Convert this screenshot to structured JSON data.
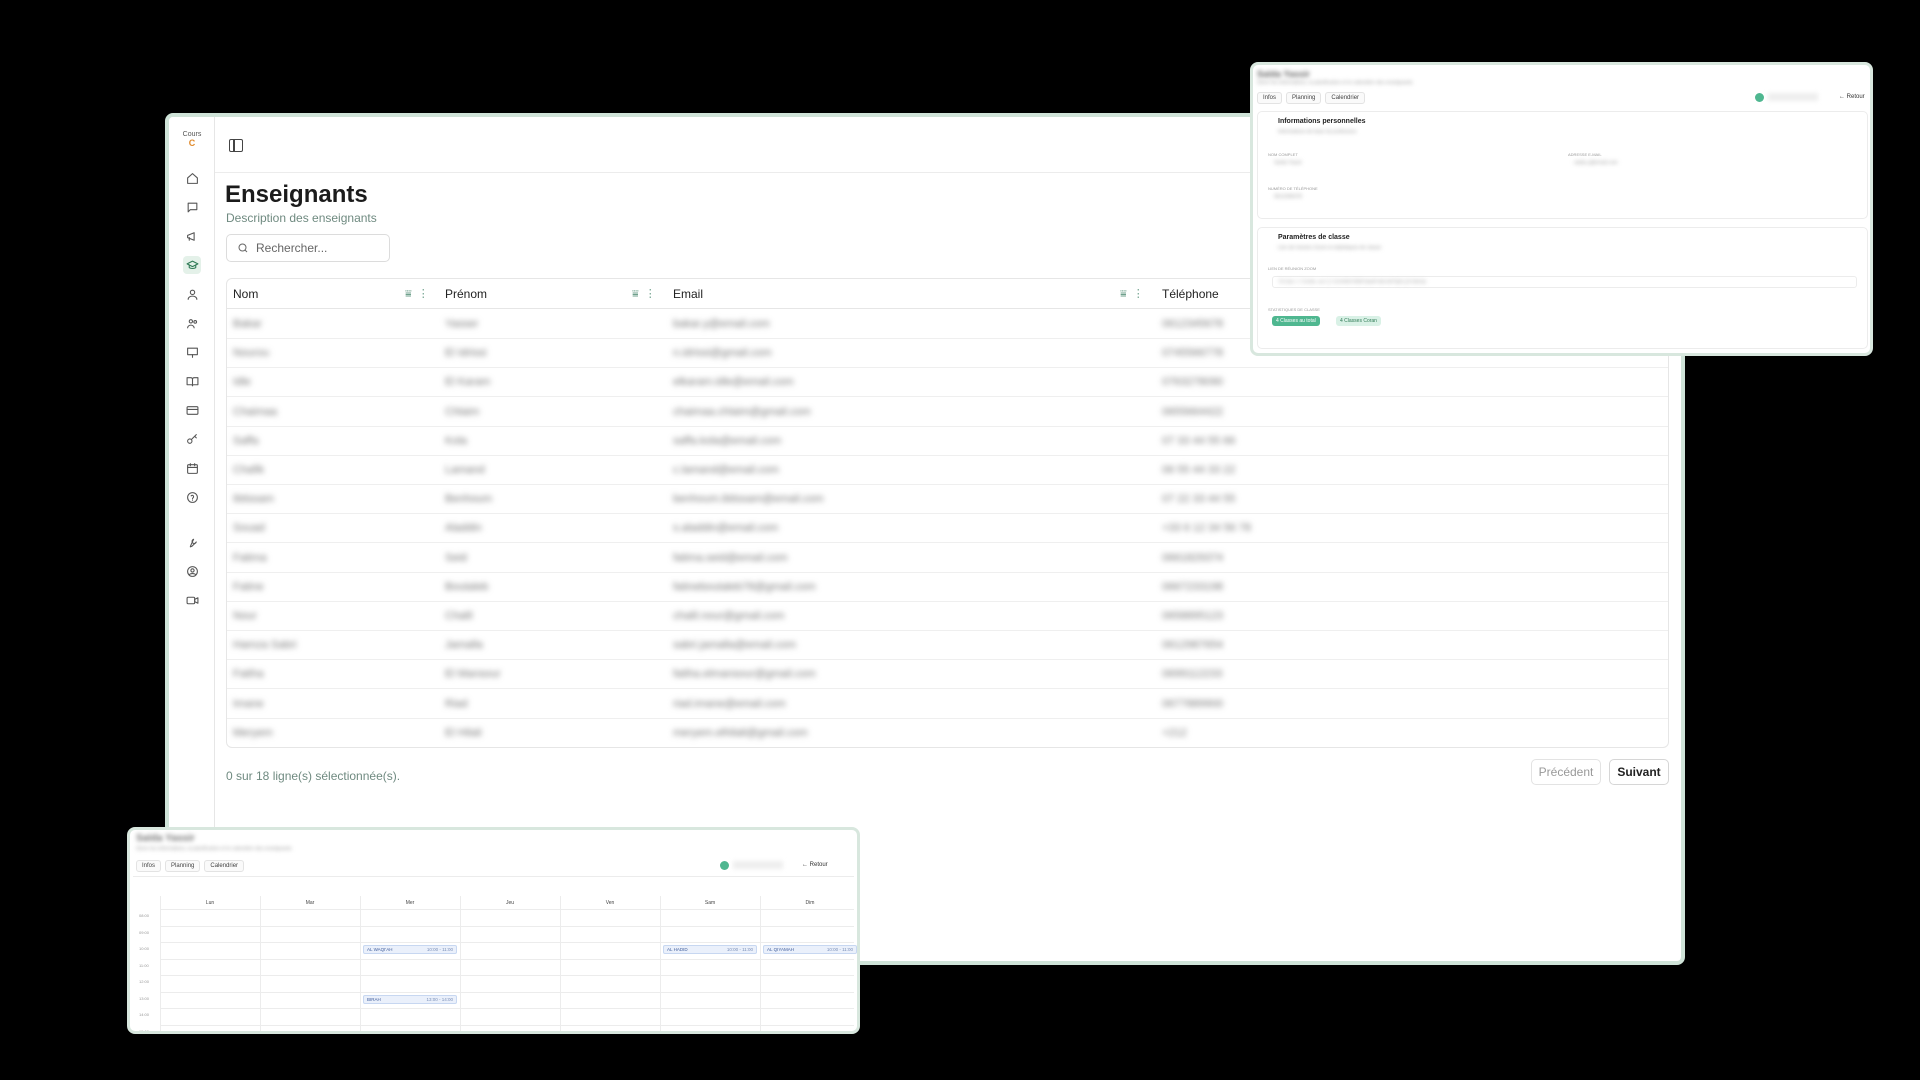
{
  "logo": {
    "line1": "Cours",
    "line2": "C"
  },
  "page": {
    "title": "Enseignants",
    "description": "Description des enseignants"
  },
  "search": {
    "placeholder": "Rechercher..."
  },
  "table": {
    "columns": [
      "Nom",
      "Prénom",
      "Email",
      "Téléphone"
    ],
    "rows": [
      [
        "Bakar",
        "Yasser",
        "bakar.y@email.com",
        "0612345678"
      ],
      [
        "Nourou",
        "El Idrissi",
        "n.idrissi@gmail.com",
        "0745566778"
      ],
      [
        "Idle",
        "El Karam",
        "elkaram.idle@email.com",
        "0763278090"
      ],
      [
        "Chaimaa",
        "Chlaim",
        "chaimaa.chlaim@gmail.com",
        "0655664422"
      ],
      [
        "Saffa",
        "Kola",
        "saffa.kola@email.com",
        "07 33 44 55 66"
      ],
      [
        "Chafik",
        "Lamand",
        "c.lamand@email.com",
        "06 55 44 33 22"
      ],
      [
        "Ibtissam",
        "Benhoum",
        "benhoum.ibtissam@email.com",
        "07 22 33 44 55"
      ],
      [
        "Souad",
        "Aladdin",
        "s.aladdin@email.com",
        "+33 6 12 34 56 78"
      ],
      [
        "Fatima",
        "Seid",
        "fatima.seid@email.com",
        "0661829374"
      ],
      [
        "Fatine",
        "Boutaleb",
        "fatineboutaleb78@gmail.com",
        "0667233198"
      ],
      [
        "Nour",
        "Chalil",
        "chalil.nour@gmail.com",
        "0658895123"
      ],
      [
        "Hamza Sabri",
        "Jamalla",
        "sabri.jamalla@email.com",
        "0612987654"
      ],
      [
        "Fatiha",
        "El Mansour",
        "fatiha.elmansour@gmail.com",
        "0699112233"
      ],
      [
        "Imane",
        "Riad",
        "riad.imane@email.com",
        "0677889900"
      ],
      [
        "Meryem",
        "El Hilali",
        "meryem.elhilali@gmail.com",
        "+212"
      ]
    ]
  },
  "footer": {
    "selection": "0 sur 18 ligne(s) sélectionnée(s).",
    "prev": "Précédent",
    "next": "Suivant"
  },
  "info_panel": {
    "name": "Saïda Yassir",
    "subtitle": "Gérer les informations, la planification et le calendrier des enseignants",
    "tabs": [
      "Infos",
      "Planning",
      "Calendrier"
    ],
    "back": "Retour",
    "personal": {
      "title": "Informations personnelles",
      "subtitle": "Informations de base du professeur",
      "full_name_label": "Nom complet",
      "full_name": "Saïda Yassir",
      "email_label": "Adresse e-mail",
      "email": "saida.y@email.com",
      "phone_label": "Numéro de téléphone",
      "phone": "0612345678"
    },
    "class": {
      "title": "Paramètres de classe",
      "subtitle": "Lien de réunion Zoom et statistiques de classe",
      "zoom_label": "Lien de réunion Zoom",
      "zoom_link": "https://zoom.us/j/1234567890?pwd=abcdefghijklmnop",
      "stats_label": "Statistiques de classe",
      "stat1": "4 Classes au total",
      "stat2": "4 Classes Coran"
    }
  },
  "calendar_panel": {
    "name": "Saïda Yassir",
    "subtitle": "Gérer les informations, la planification et le calendrier des enseignants",
    "tabs": [
      "Infos",
      "Planning",
      "Calendrier"
    ],
    "back": "Retour",
    "days": [
      "Lun",
      "Mar",
      "Mer",
      "Jeu",
      "Ven",
      "Sam",
      "Dim"
    ],
    "hours": [
      "08:00",
      "09:00",
      "10:00",
      "11:00",
      "12:00",
      "13:00",
      "14:00",
      "15:00"
    ],
    "events": [
      {
        "label": "AL WAQI'AH",
        "time": "10:00 - 11:00"
      },
      {
        "label": "BIRAH",
        "time": "13:00 - 14:00"
      },
      {
        "label": "AL HADID",
        "time": "10:00 - 11:00"
      },
      {
        "label": "AL QIYAMAH",
        "time": "10:00 - 11:00"
      }
    ]
  },
  "colors": {
    "accent": "#2f7a55",
    "muted": "#6f8a80",
    "frame": "#cfe3d8"
  }
}
